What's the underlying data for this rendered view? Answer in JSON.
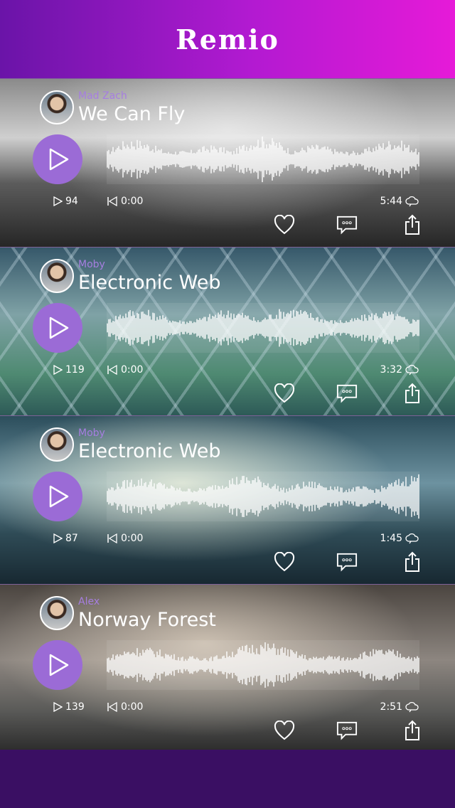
{
  "app": {
    "logo": "Remio"
  },
  "tracks": [
    {
      "artist": "Mad Zach",
      "title": "We Can Fly",
      "plays": "94",
      "position": "0:00",
      "duration": "5:44"
    },
    {
      "artist": "Moby",
      "title": "Electronic Web",
      "plays": "119",
      "position": "0:00",
      "duration": "3:32"
    },
    {
      "artist": "Moby",
      "title": "Electronic Web",
      "plays": "87",
      "position": "0:00",
      "duration": "1:45"
    },
    {
      "artist": "Alex",
      "title": "Norway Forest",
      "plays": "139",
      "position": "0:00",
      "duration": "2:51"
    }
  ],
  "icons": {
    "play": "play-icon",
    "like": "heart-icon",
    "comment": "comment-icon",
    "share": "share-icon",
    "cloud": "cloud-icon",
    "skip_back": "skip-back-icon"
  },
  "colors": {
    "accent": "#9b6bd6",
    "artist": "#a67ee0",
    "header_left": "#6a14a8",
    "header_right": "#e61ad8",
    "footer": "#3a0f63"
  }
}
